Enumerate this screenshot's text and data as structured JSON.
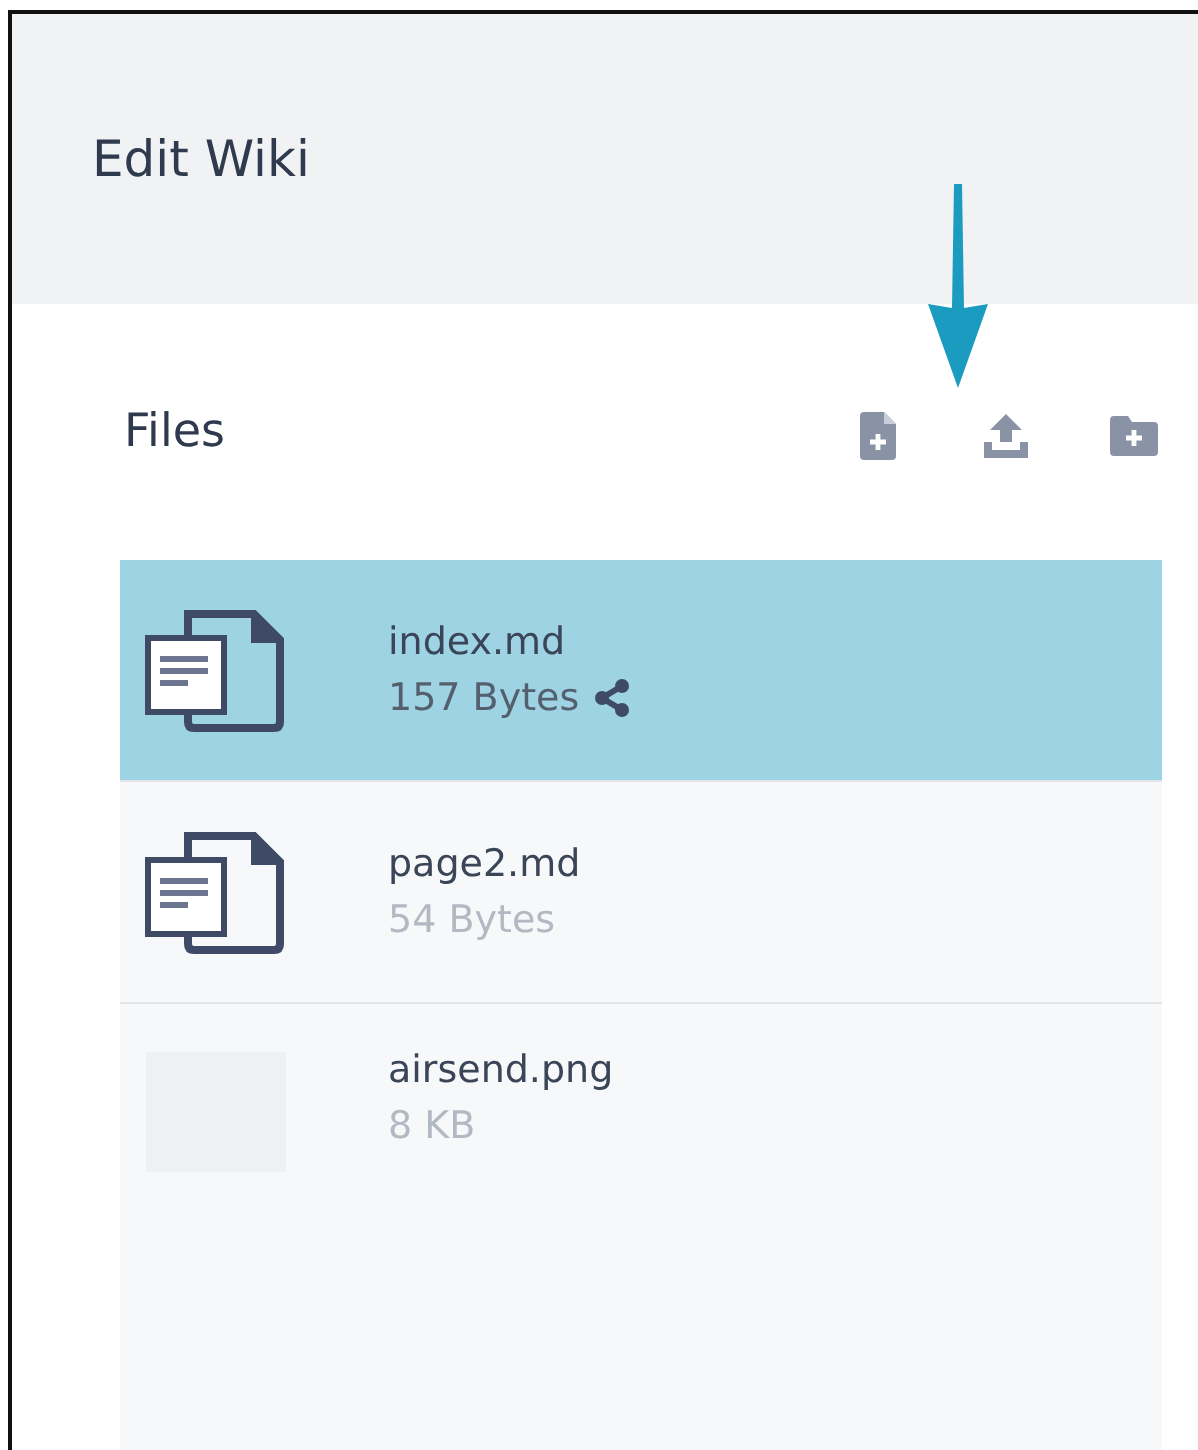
{
  "header": {
    "title": "Edit Wiki"
  },
  "files_panel": {
    "title": "Files"
  },
  "files": [
    {
      "kind": "document",
      "name": "index.md",
      "size": "157 Bytes",
      "selected": true,
      "shared": true
    },
    {
      "kind": "document",
      "name": "page2.md",
      "size": "54 Bytes",
      "selected": false,
      "shared": false
    },
    {
      "kind": "image",
      "name": "airsend.png",
      "size": "8 KB",
      "selected": false,
      "shared": false
    }
  ]
}
